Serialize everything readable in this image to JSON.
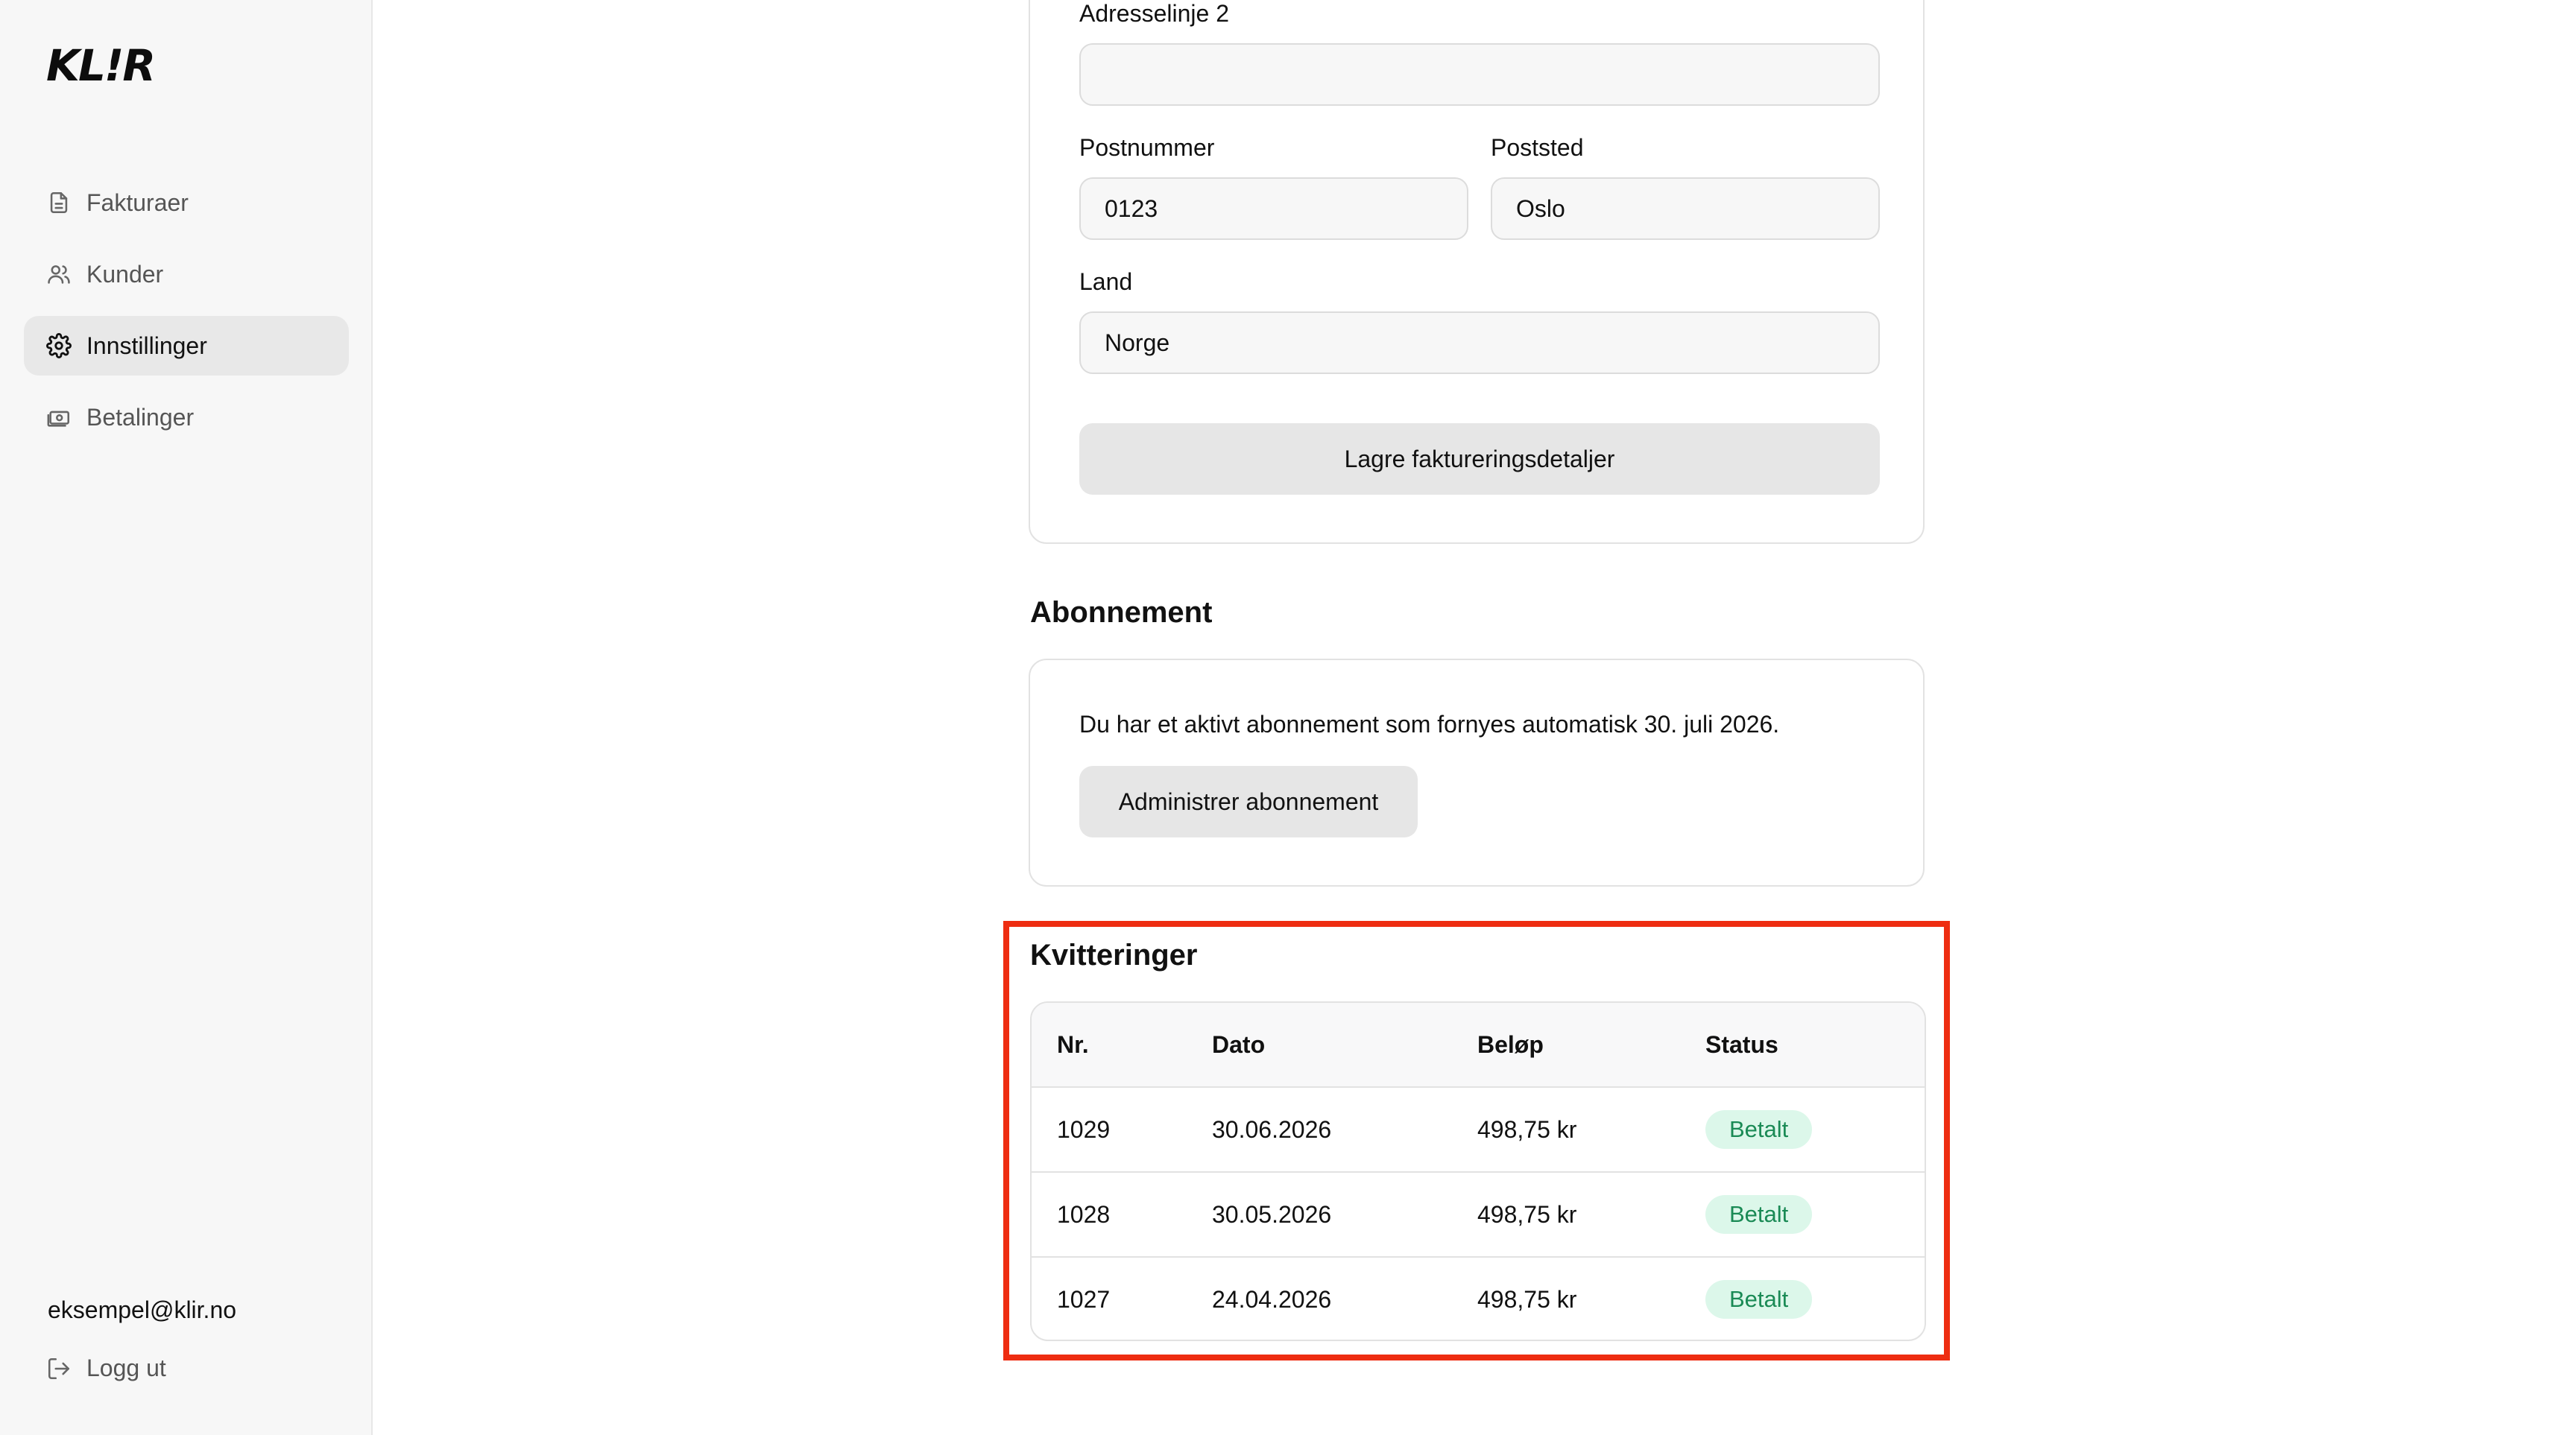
{
  "app": {
    "logo": "KL!R"
  },
  "sidebar": {
    "items": [
      {
        "label": "Fakturaer",
        "icon": "document-icon"
      },
      {
        "label": "Kunder",
        "icon": "users-icon"
      },
      {
        "label": "Innstillinger",
        "icon": "gear-icon",
        "active": true
      },
      {
        "label": "Betalinger",
        "icon": "banknote-icon"
      }
    ],
    "user_email": "eksempel@klir.no",
    "logout_label": "Logg ut"
  },
  "billing_form": {
    "address_line2": {
      "label": "Adresselinje 2",
      "value": ""
    },
    "postal_code": {
      "label": "Postnummer",
      "value": "0123"
    },
    "city": {
      "label": "Poststed",
      "value": "Oslo"
    },
    "country": {
      "label": "Land",
      "value": "Norge"
    },
    "save_label": "Lagre faktureringsdetaljer"
  },
  "subscription": {
    "title": "Abonnement",
    "text": "Du har et aktivt abonnement som fornyes automatisk 30. juli 2026.",
    "manage_label": "Administrer abonnement"
  },
  "receipts": {
    "title": "Kvitteringer",
    "columns": [
      "Nr.",
      "Dato",
      "Beløp",
      "Status"
    ],
    "rows": [
      {
        "nr": "1029",
        "date": "30.06.2026",
        "amount": "498,75 kr",
        "status": "Betalt"
      },
      {
        "nr": "1028",
        "date": "30.05.2026",
        "amount": "498,75 kr",
        "status": "Betalt"
      },
      {
        "nr": "1027",
        "date": "24.04.2026",
        "amount": "498,75 kr",
        "status": "Betalt"
      }
    ]
  },
  "colors": {
    "highlight": "#ee2d11",
    "badge_bg": "#dcf7ea",
    "badge_text": "#1a8a55",
    "sidebar_bg": "#f7f7f7",
    "active_item_bg": "#e8e8e8"
  }
}
